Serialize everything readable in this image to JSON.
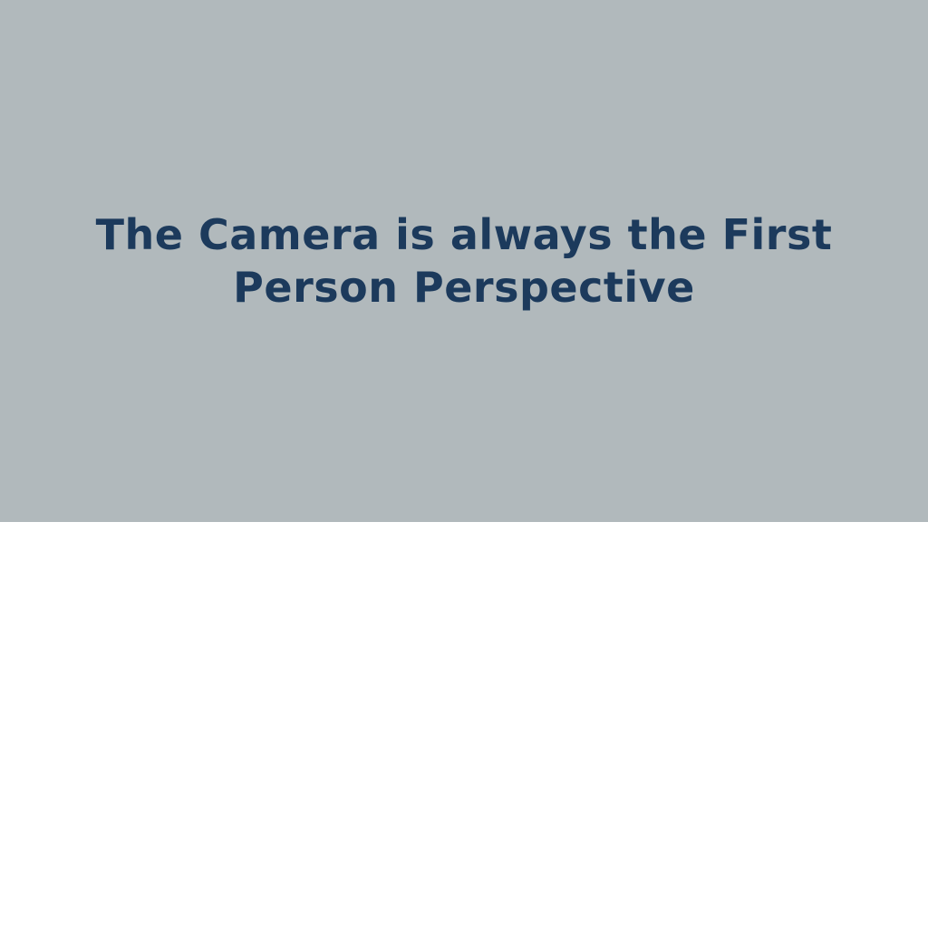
{
  "slide": {
    "title_lines": [
      "The Camera is always the First",
      "Person Perspective"
    ]
  },
  "colors": {
    "slide_background": "#b1b9bc",
    "title_text": "#1c3a5c",
    "page_background": "#ffffff"
  }
}
